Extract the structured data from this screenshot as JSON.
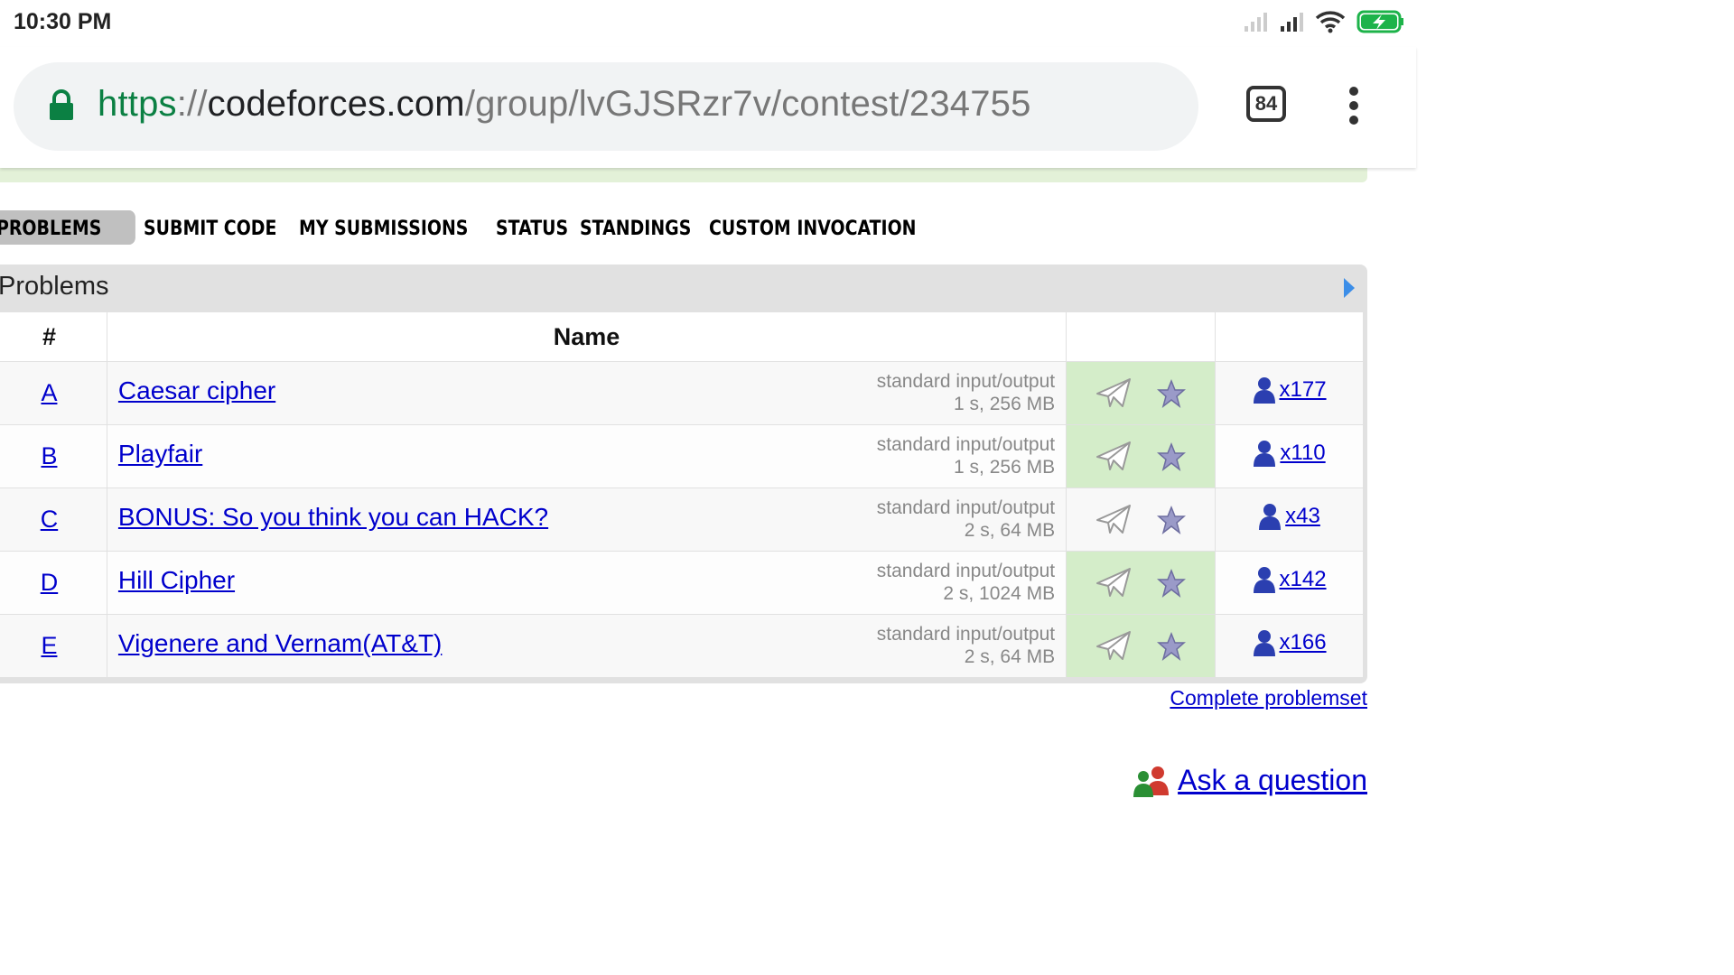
{
  "status_bar": {
    "time": "10:30 PM"
  },
  "address_bar": {
    "url_scheme": "https",
    "url_separator": "://",
    "url_host": "codeforces.com",
    "url_path": "/group/lvGJSRzr7v/contest/234755",
    "tab_count": "84"
  },
  "menu": {
    "items": [
      "PROBLEMS",
      "SUBMIT CODE",
      "MY SUBMISSIONS",
      "STATUS",
      "STANDINGS",
      "CUSTOM INVOCATION"
    ],
    "active": "PROBLEMS"
  },
  "problems": {
    "title": "Problems",
    "headers": {
      "index": "#",
      "name": "Name"
    },
    "rows": [
      {
        "letter": "A",
        "name": "Caesar cipher",
        "io": "standard input/output",
        "limits": "1 s, 256 MB",
        "solved": true,
        "count": "x177"
      },
      {
        "letter": "B",
        "name": "Playfair",
        "io": "standard input/output",
        "limits": "1 s, 256 MB",
        "solved": true,
        "count": "x110"
      },
      {
        "letter": "C",
        "name": "BONUS: So you think you can HACK?",
        "io": "standard input/output",
        "limits": "2 s, 64 MB",
        "solved": false,
        "count": "x43"
      },
      {
        "letter": "D",
        "name": "Hill Cipher",
        "io": "standard input/output",
        "limits": "2 s, 1024 MB",
        "solved": true,
        "count": "x142"
      },
      {
        "letter": "E",
        "name": "Vigenere and Vernam(AT&T)",
        "io": "standard input/output",
        "limits": "2 s, 64 MB",
        "solved": true,
        "count": "x166"
      }
    ]
  },
  "complete_link": "Complete problemset",
  "ask_link": "Ask a question",
  "colors": {
    "link": "#0000cc",
    "solved_bg": "#d4edc9",
    "https_green": "#0b8043"
  }
}
